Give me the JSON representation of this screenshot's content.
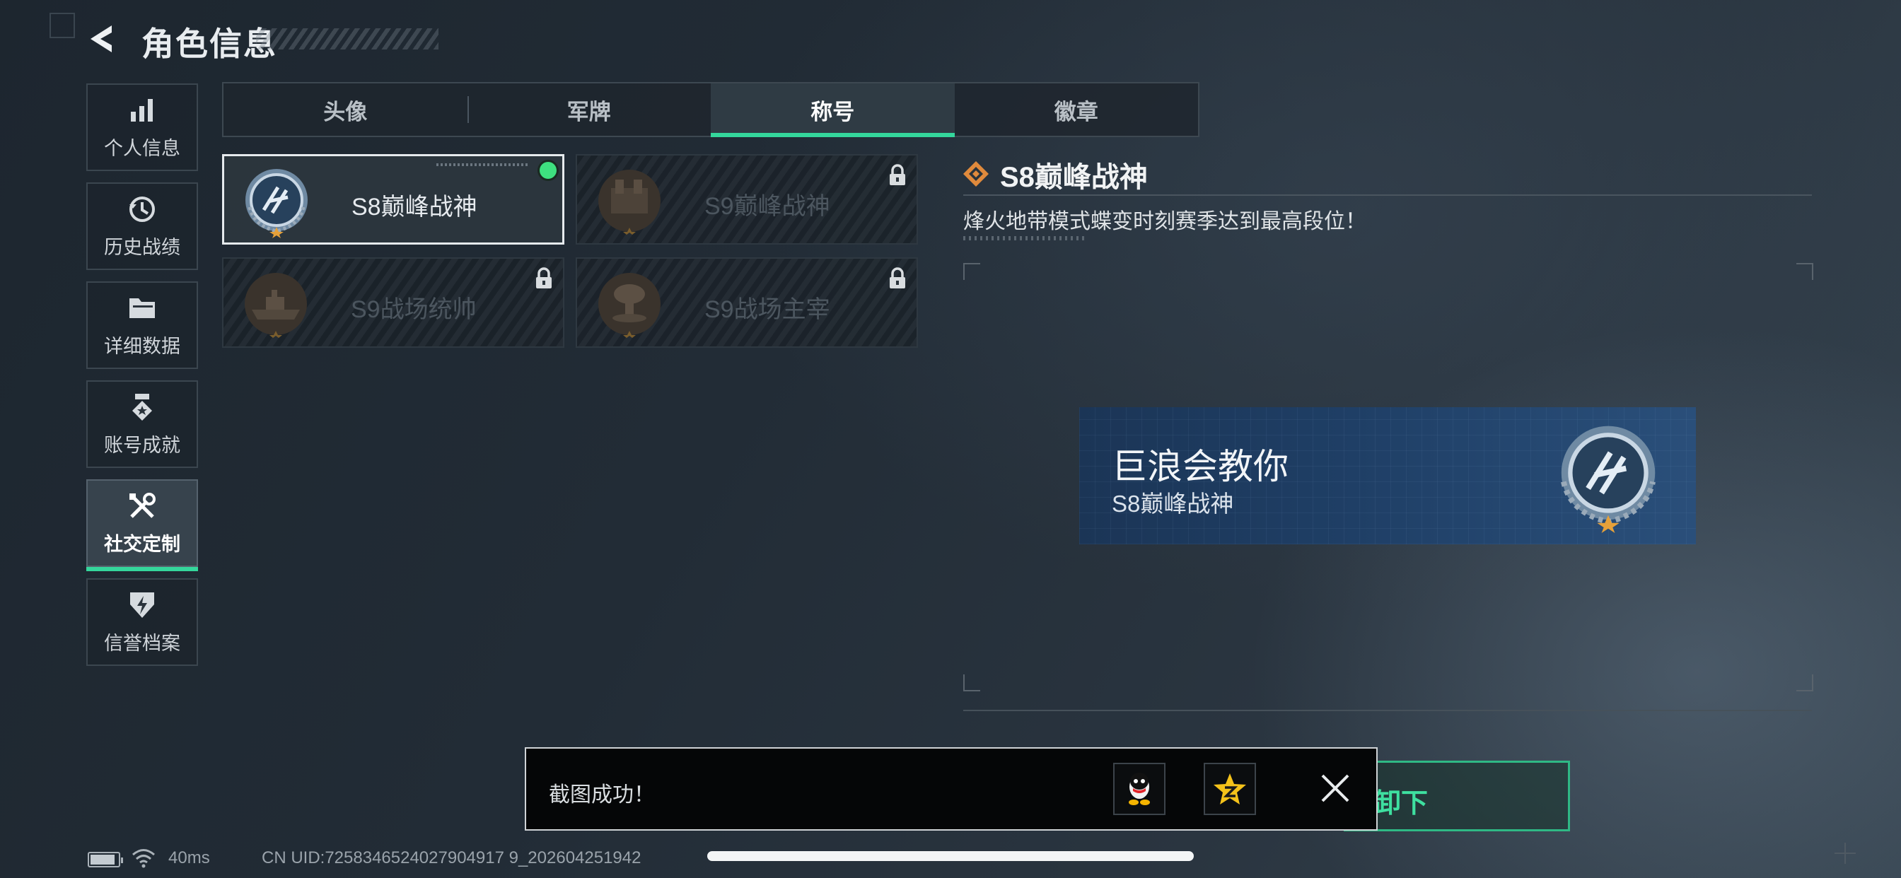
{
  "header": {
    "title": "角色信息"
  },
  "sidebar": {
    "items": [
      {
        "label": "个人信息",
        "icon": "bar-chart-icon"
      },
      {
        "label": "历史战绩",
        "icon": "history-icon"
      },
      {
        "label": "详细数据",
        "icon": "folder-icon"
      },
      {
        "label": "账号成就",
        "icon": "achievement-icon"
      },
      {
        "label": "社交定制",
        "icon": "tools-icon",
        "active": true
      },
      {
        "label": "信誉档案",
        "icon": "credit-shield-icon"
      }
    ]
  },
  "tabs": [
    {
      "label": "头像"
    },
    {
      "label": "军牌"
    },
    {
      "label": "称号",
      "active": true
    },
    {
      "label": "徽章"
    }
  ],
  "titles": [
    {
      "name": "S8巅峰战神",
      "selected": true,
      "locked": false
    },
    {
      "name": "S9巅峰战神",
      "selected": false,
      "locked": true
    },
    {
      "name": "S9战场统帅",
      "selected": false,
      "locked": true
    },
    {
      "name": "S9战场主宰",
      "selected": false,
      "locked": true
    }
  ],
  "detail": {
    "title": "S8巅峰战神",
    "description": "烽火地带模式蝶变时刻赛季达到最高段位！"
  },
  "preview": {
    "player_name": "巨浪会教你",
    "title": "S8巅峰战神"
  },
  "toast": {
    "message": "截图成功！",
    "share_targets": [
      "qq-icon",
      "qzone-icon"
    ],
    "close_icon": "close-icon"
  },
  "background_button": {
    "label_fragment": "卸下"
  },
  "footer": {
    "ping": "40ms",
    "uid": "CN UID:7258346524027904917 9_202604251942"
  },
  "colors": {
    "accent_green": "#34d79c",
    "selected_dot": "#3ee07f",
    "banner_blue": "#1f3f66",
    "title_icon_orange": "#e08a3c"
  }
}
